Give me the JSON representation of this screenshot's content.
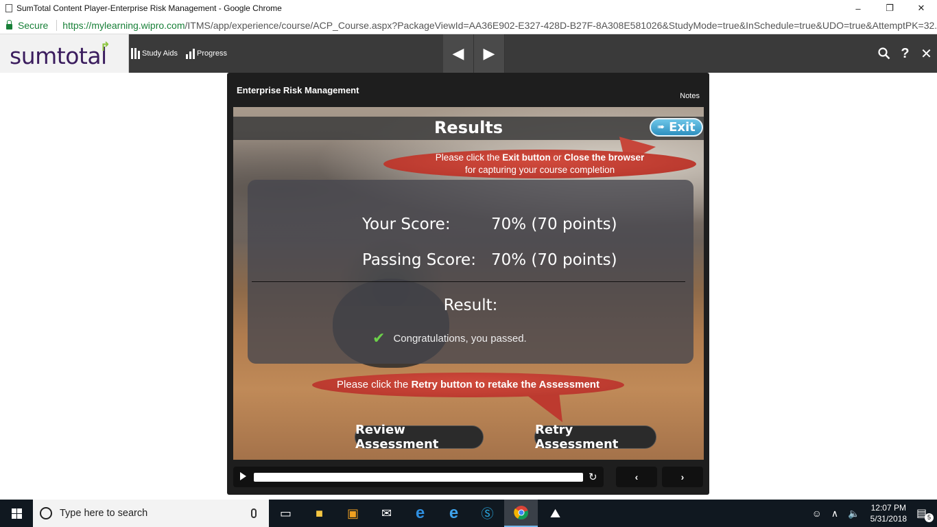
{
  "window": {
    "title": "SumTotal Content Player-Enterprise Risk Management - Google Chrome",
    "minimize": "–",
    "restore": "❐",
    "close": "✕"
  },
  "address_bar": {
    "secure_label": "Secure",
    "url_host": "https://mylearning.wipro.com",
    "url_path": "/ITMS/app/experience/course/ACP_Course.aspx?PackageViewId=AA36E902-E327-428D-B27F-8A308E581026&StudyMode=true&InSchedule=true&UDO=true&AttemptPK=32..."
  },
  "app_toolbar": {
    "logo_text": "sumtotal",
    "study_aids_label": "Study Aids",
    "progress_label": "Progress",
    "prev_glyph": "◀",
    "next_glyph": "▶",
    "search_glyph": "🔍",
    "help_glyph": "?",
    "close_glyph": "✕"
  },
  "player": {
    "course_title": "Enterprise Risk Management",
    "notes_label": "Notes",
    "results_title": "Results",
    "exit_label": "Exit",
    "top_callout": {
      "prefix": "Please click the ",
      "exit_bold": "Exit button",
      "mid": " or ",
      "close_bold": "Close the browser",
      "line2": "for capturing your course completion"
    },
    "score_panel": {
      "your_score_label": "Your Score:",
      "your_score_value": "70% (70 points)",
      "passing_score_label": "Passing Score:",
      "passing_score_value": "70% (70 points)",
      "result_label": "Result:",
      "result_message": "Congratulations, you passed."
    },
    "bottom_callout": {
      "prefix": "Please click the ",
      "bold": "Retry button to retake the Assessment"
    },
    "review_button": "Review Assessment",
    "retry_button": "Retry Assessment",
    "controls": {
      "prev_glyph": "‹",
      "next_glyph": "›",
      "replay_glyph": "↻"
    }
  },
  "taskbar": {
    "search_placeholder": "Type here to search",
    "time": "12:07 PM",
    "date": "5/31/2018",
    "notification_count": "5"
  }
}
